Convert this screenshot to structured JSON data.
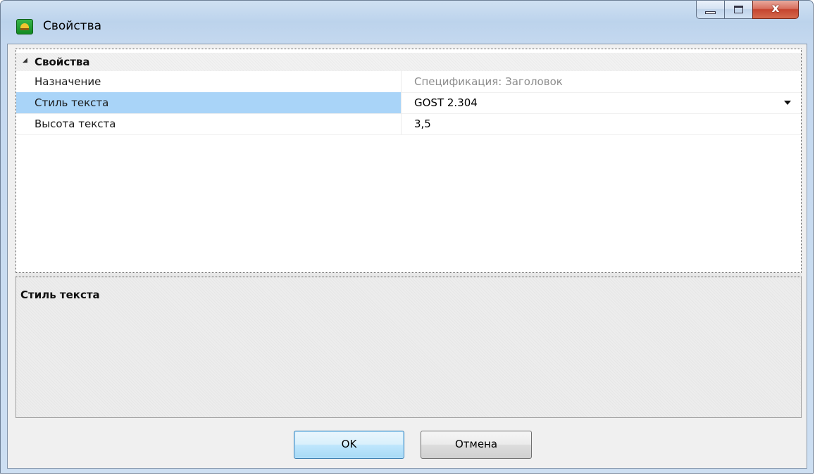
{
  "window": {
    "title": "Свойства",
    "buttons": {
      "minimize": "minimize",
      "maximize": "maximize",
      "close": "x"
    }
  },
  "property_grid": {
    "category": "Свойства",
    "rows": [
      {
        "name": "Назначение",
        "value": "Спецификация: Заголовок",
        "readonly": true
      },
      {
        "name": "Стиль текста",
        "value": "GOST 2.304",
        "selected": true,
        "has_dropdown": true
      },
      {
        "name": "Высота текста",
        "value": "3,5"
      }
    ]
  },
  "description": {
    "title": "Стиль текста"
  },
  "footer": {
    "ok_label": "OK",
    "cancel_label": "Отмена"
  },
  "colors": {
    "selection": "#a9d4f8",
    "readonly_text": "#8c8c8c",
    "ok_border": "#3c7fb1"
  }
}
